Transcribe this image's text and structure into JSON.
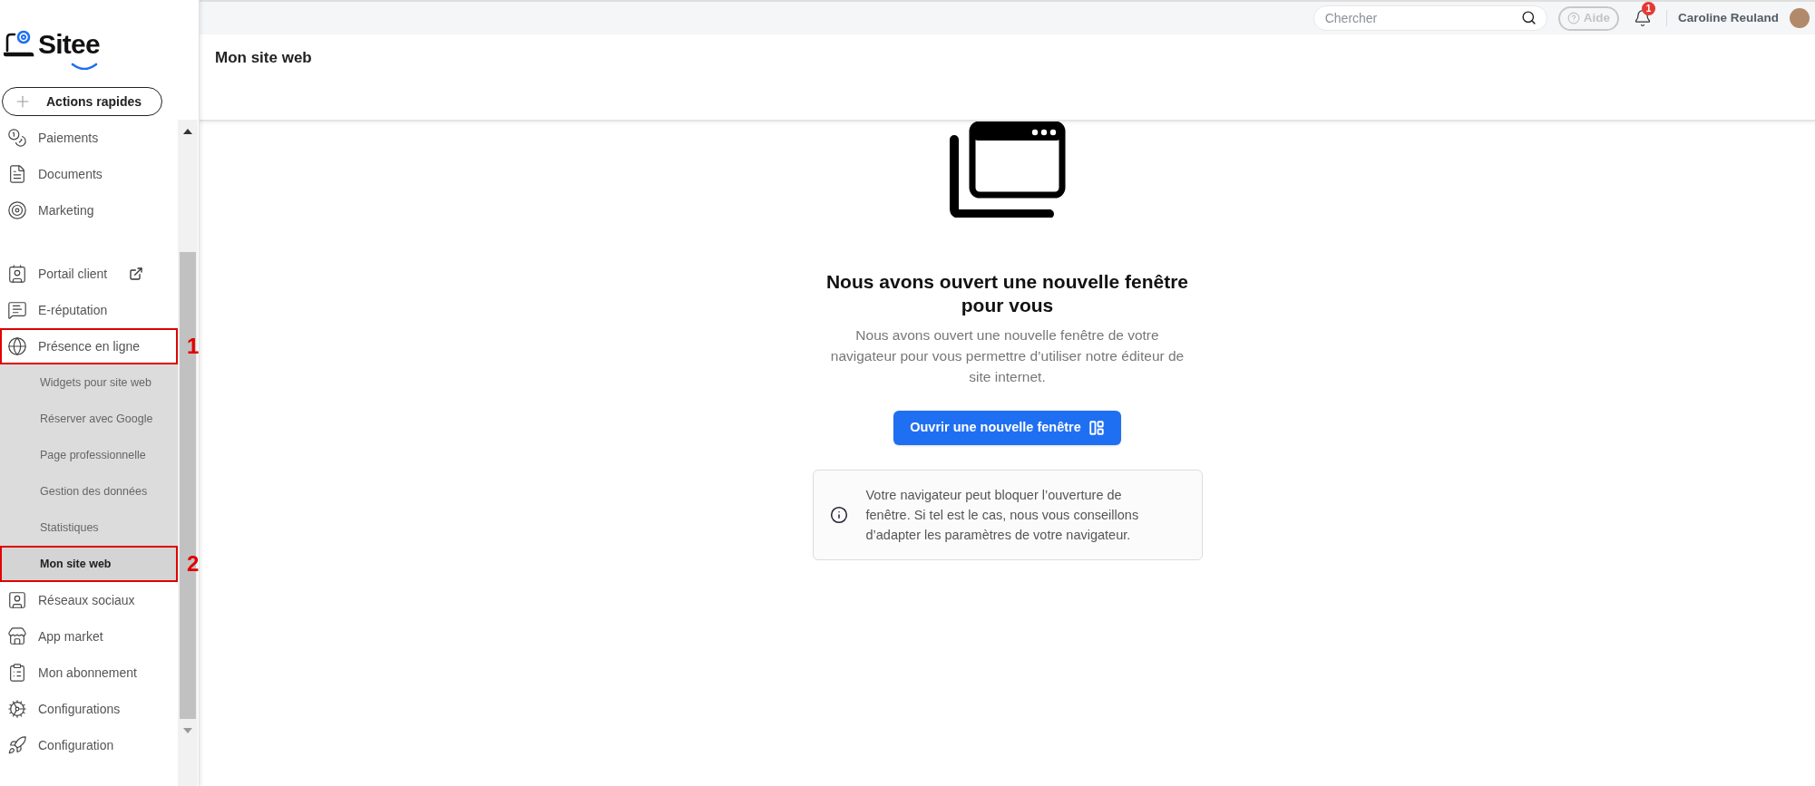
{
  "logo": {
    "text": "Sitee"
  },
  "quick_actions": {
    "label": "Actions rapides"
  },
  "sidebar": {
    "groups": [
      [
        {
          "label": "Paiements",
          "selected": false
        },
        {
          "label": "Documents",
          "selected": false
        },
        {
          "label": "Marketing",
          "selected": false
        }
      ],
      [
        {
          "label": "Portail client",
          "selected": false,
          "external": true
        },
        {
          "label": "E-réputation",
          "selected": false
        },
        {
          "label": "Présence en ligne",
          "selected": false,
          "expanded": true,
          "annotation": "1",
          "children": [
            {
              "label": "Widgets pour site web",
              "selected": false
            },
            {
              "label": "Réserver avec Google",
              "selected": false
            },
            {
              "label": "Page professionnelle",
              "selected": false
            },
            {
              "label": "Gestion des données",
              "selected": false
            },
            {
              "label": "Statistiques",
              "selected": false
            },
            {
              "label": "Mon site web",
              "selected": true,
              "annotation": "2"
            }
          ]
        },
        {
          "label": "Réseaux sociaux",
          "selected": false
        },
        {
          "label": "App market",
          "selected": false
        },
        {
          "label": "Mon abonnement",
          "selected": false
        },
        {
          "label": "Configurations",
          "selected": false
        },
        {
          "label": "Configuration",
          "selected": false
        }
      ]
    ]
  },
  "topbar": {
    "search": {
      "placeholder": "Chercher"
    },
    "help": {
      "label": "Aide",
      "disabled": true
    },
    "notifications": {
      "count": "1"
    },
    "user": {
      "name": "Caroline Reuland"
    }
  },
  "page_title": "Mon site web",
  "prompt": {
    "heading": "Nous avons ouvert une nouvelle fenêtre pour vous",
    "text": "Nous avons ouvert une nouvelle fenêtre de votre navigateur pour vous permettre d’utiliser notre éditeur de site internet.",
    "button": "Ouvrir une nouvelle fenêtre",
    "notice": "Votre navigateur peut bloquer l’ouverture de fenêtre. Si tel est le cas, nous vous conseillons d’adapter les paramètres de votre navigateur."
  }
}
